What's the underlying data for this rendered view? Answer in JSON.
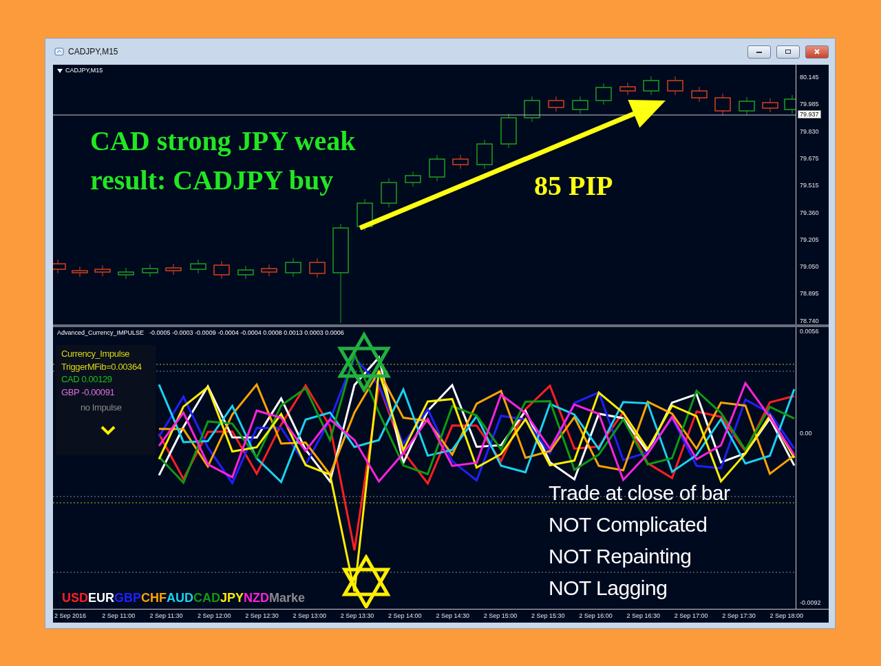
{
  "window": {
    "title": "CADJPY,M15"
  },
  "price_pane": {
    "symbol_label": "CADJPY,M15",
    "headline": [
      "CAD strong JPY weak",
      "result: CADJPY buy"
    ],
    "move_label": "85 PIP",
    "price_ticks": [
      "80.145",
      "79.985",
      "79.830",
      "79.675",
      "79.515",
      "79.360",
      "79.205",
      "79.050",
      "78.895",
      "78.740"
    ],
    "current_price": "79.937"
  },
  "indicator_pane": {
    "name": "Advanced_Currency_IMPULSE",
    "values": "-0.0005 -0.0003 -0.0009 -0.0004 -0.0004 0.0008 0.0013 0.0003 0.0006",
    "legend": {
      "title": "Currency_Impulse",
      "trigger": "TriggerMFib=0.00364",
      "readings": [
        {
          "text": "CAD 0.00129",
          "color": "#19c019"
        },
        {
          "text": "GBP -0.00091",
          "color": "#e070e0"
        }
      ],
      "status": "no Impulse"
    },
    "notes": [
      "Trade at close of bar",
      "NOT Complicated",
      "NOT Repainting",
      "NOT Lagging"
    ],
    "currencies": [
      {
        "code": "USD",
        "color": "#ff2020"
      },
      {
        "code": "EUR",
        "color": "#ffffff"
      },
      {
        "code": "GBP",
        "color": "#2020ff"
      },
      {
        "code": "CHF",
        "color": "#ffa500"
      },
      {
        "code": "AUD",
        "color": "#19d3f0"
      },
      {
        "code": "CAD",
        "color": "#119911"
      },
      {
        "code": "JPY",
        "color": "#ffee00"
      },
      {
        "code": "NZD",
        "color": "#ff22dd"
      },
      {
        "code": "Marke",
        "color": "#8a8a8a"
      }
    ],
    "axis_ticks": [
      "0.0056",
      "0.00",
      "-0.0092"
    ]
  },
  "time_axis": [
    "2 Sep 2016",
    "2 Sep 11:00",
    "2 Sep 11:30",
    "2 Sep 12:00",
    "2 Sep 12:30",
    "2 Sep 13:00",
    "2 Sep 13:30",
    "2 Sep 14:00",
    "2 Sep 14:30",
    "2 Sep 15:00",
    "2 Sep 15:30",
    "2 Sep 16:00",
    "2 Sep 16:30",
    "2 Sep 17:00",
    "2 Sep 17:30",
    "2 Sep 18:00"
  ]
}
